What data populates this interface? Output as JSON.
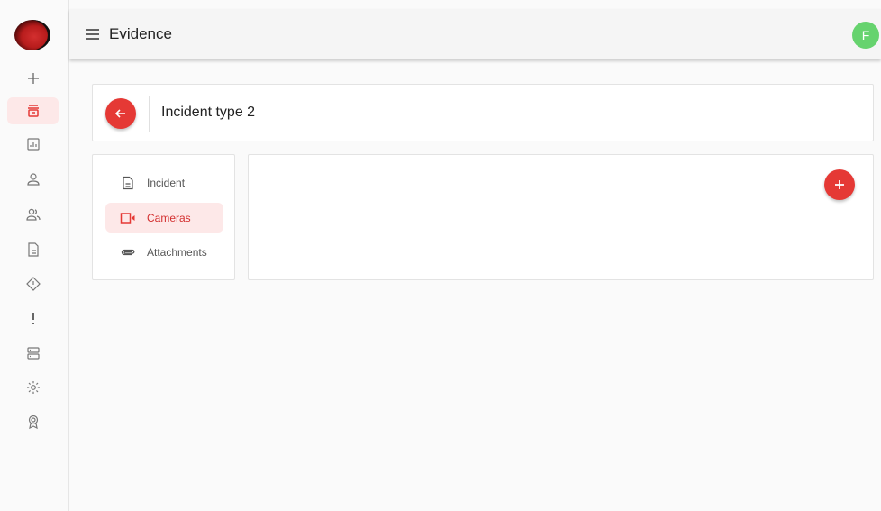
{
  "header": {
    "title": "Evidence",
    "avatar_initial": "F"
  },
  "sidebar": {
    "items": [
      {
        "icon": "plus-icon"
      },
      {
        "icon": "archive-icon",
        "active": true
      },
      {
        "icon": "report-icon"
      },
      {
        "icon": "user-icon"
      },
      {
        "icon": "users-icon"
      },
      {
        "icon": "document-icon"
      },
      {
        "icon": "warning-diamond-icon"
      },
      {
        "icon": "exclamation-icon"
      },
      {
        "icon": "server-icon"
      },
      {
        "icon": "settings-icon"
      },
      {
        "icon": "badge-icon"
      }
    ]
  },
  "incident": {
    "title": "Incident type 2"
  },
  "tabs": [
    {
      "label": "Incident",
      "icon": "document-icon"
    },
    {
      "label": "Cameras",
      "icon": "camera-icon",
      "active": true
    },
    {
      "label": "Attachments",
      "icon": "paperclip-icon"
    }
  ],
  "colors": {
    "accent": "#e53935",
    "active_bg": "#fde8e8",
    "avatar": "#66d36e"
  }
}
